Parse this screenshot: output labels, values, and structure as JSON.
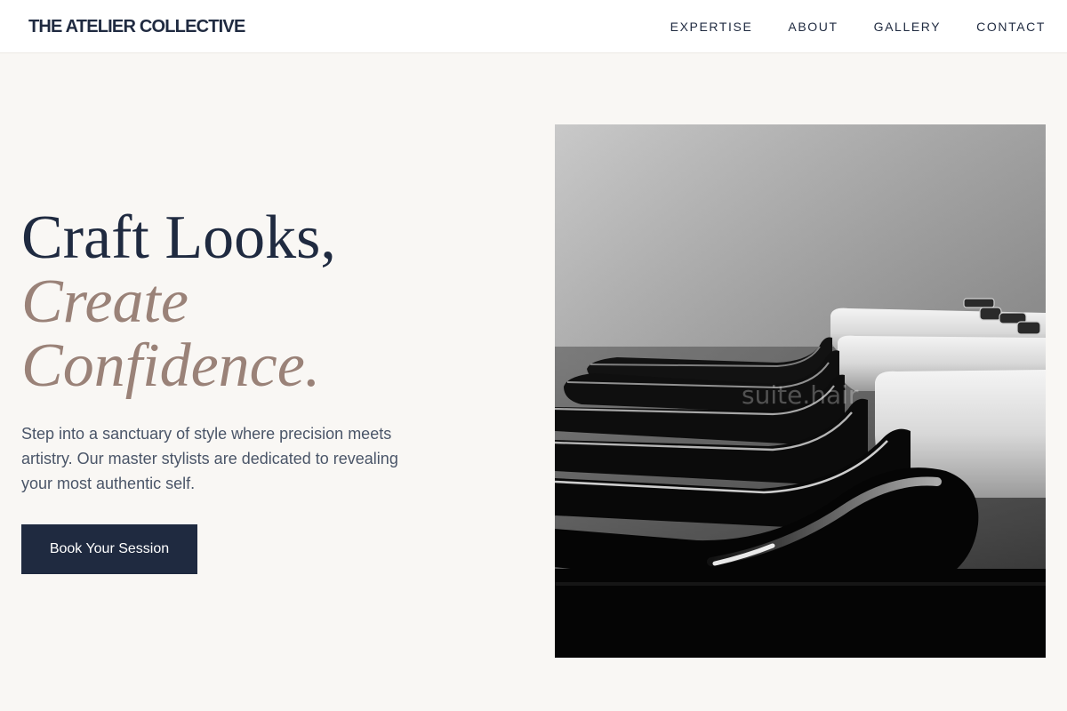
{
  "header": {
    "brand": "THE ATELIER COLLECTIVE",
    "nav": [
      {
        "label": "EXPERTISE"
      },
      {
        "label": "ABOUT"
      },
      {
        "label": "GALLERY"
      },
      {
        "label": "CONTACT"
      }
    ]
  },
  "hero": {
    "title_line1": "Craft Looks,",
    "title_line2": "Create",
    "title_line3": "Confidence.",
    "description": "Step into a sanctuary of style where precision meets artistry. Our master stylists are dedicated to revealing your most authentic self.",
    "cta_label": "Book Your Session",
    "image_watermark": "suite.hair"
  },
  "colors": {
    "page_background": "#f9f7f4",
    "navy": "#1f2a40",
    "accent_taupe": "#9a8278",
    "body_text": "#4a5568"
  }
}
